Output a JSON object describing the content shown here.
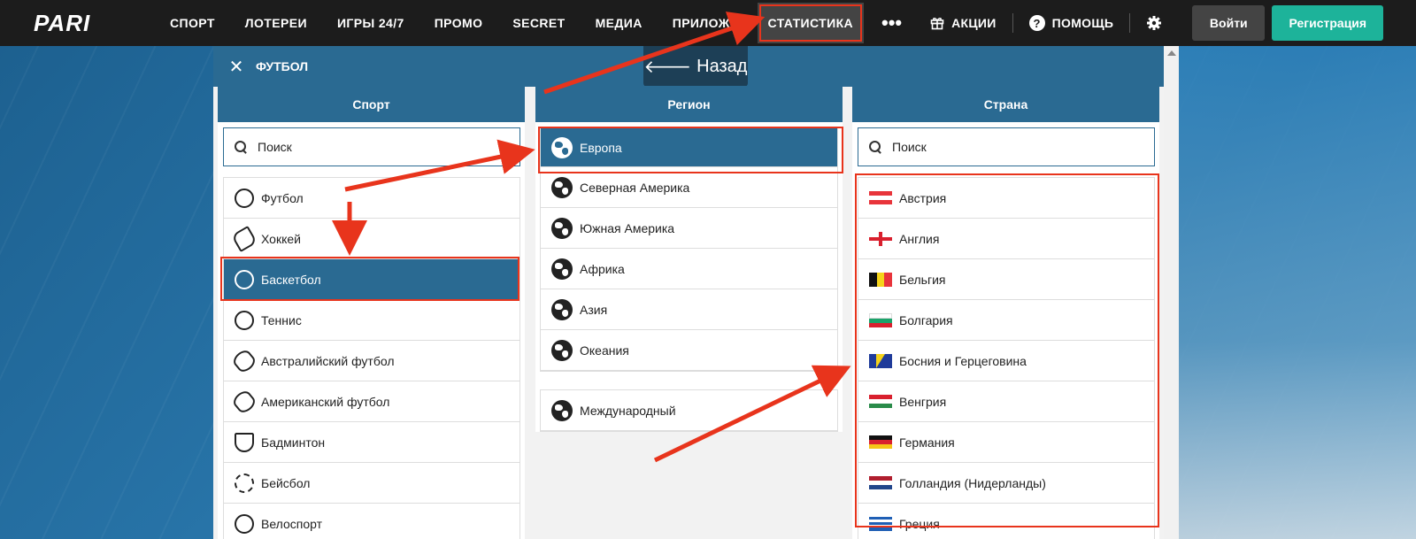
{
  "brand": {
    "logo": "PARI"
  },
  "nav": {
    "items": [
      "СПОРТ",
      "ЛОТЕРЕИ",
      "ИГРЫ 24/7",
      "ПРОМО",
      "SECRET",
      "МЕДИА",
      "ПРИЛОЖЕ"
    ],
    "active": "СТАТИСТИКА",
    "more": "•••",
    "promo": "АКЦИИ",
    "help": "ПОМОЩЬ",
    "login": "Войти",
    "register": "Регистрация"
  },
  "panel": {
    "title": "ФУТБОЛ",
    "back": "Назад",
    "sport": {
      "header": "Спорт",
      "search_placeholder": "Поиск",
      "items": [
        "Футбол",
        "Хоккей",
        "Баскетбол",
        "Теннис",
        "Австралийский футбол",
        "Американский футбол",
        "Бадминтон",
        "Бейсбол",
        "Велоспорт"
      ],
      "selected": "Баскетбол"
    },
    "region": {
      "header": "Регион",
      "items": [
        "Европа",
        "Северная Америка",
        "Южная Америка",
        "Африка",
        "Азия",
        "Океания"
      ],
      "international": "Международный",
      "selected": "Европа"
    },
    "country": {
      "header": "Страна",
      "search_placeholder": "Поиск",
      "items": [
        "Австрия",
        "Англия",
        "Бельгия",
        "Болгария",
        "Босния и Герцеговина",
        "Венгрия",
        "Германия",
        "Голландия (Нидерланды)",
        "Греция"
      ]
    }
  },
  "colors": {
    "accent": "#2a6a92",
    "highlight": "#e8341c",
    "register": "#1db39a"
  }
}
